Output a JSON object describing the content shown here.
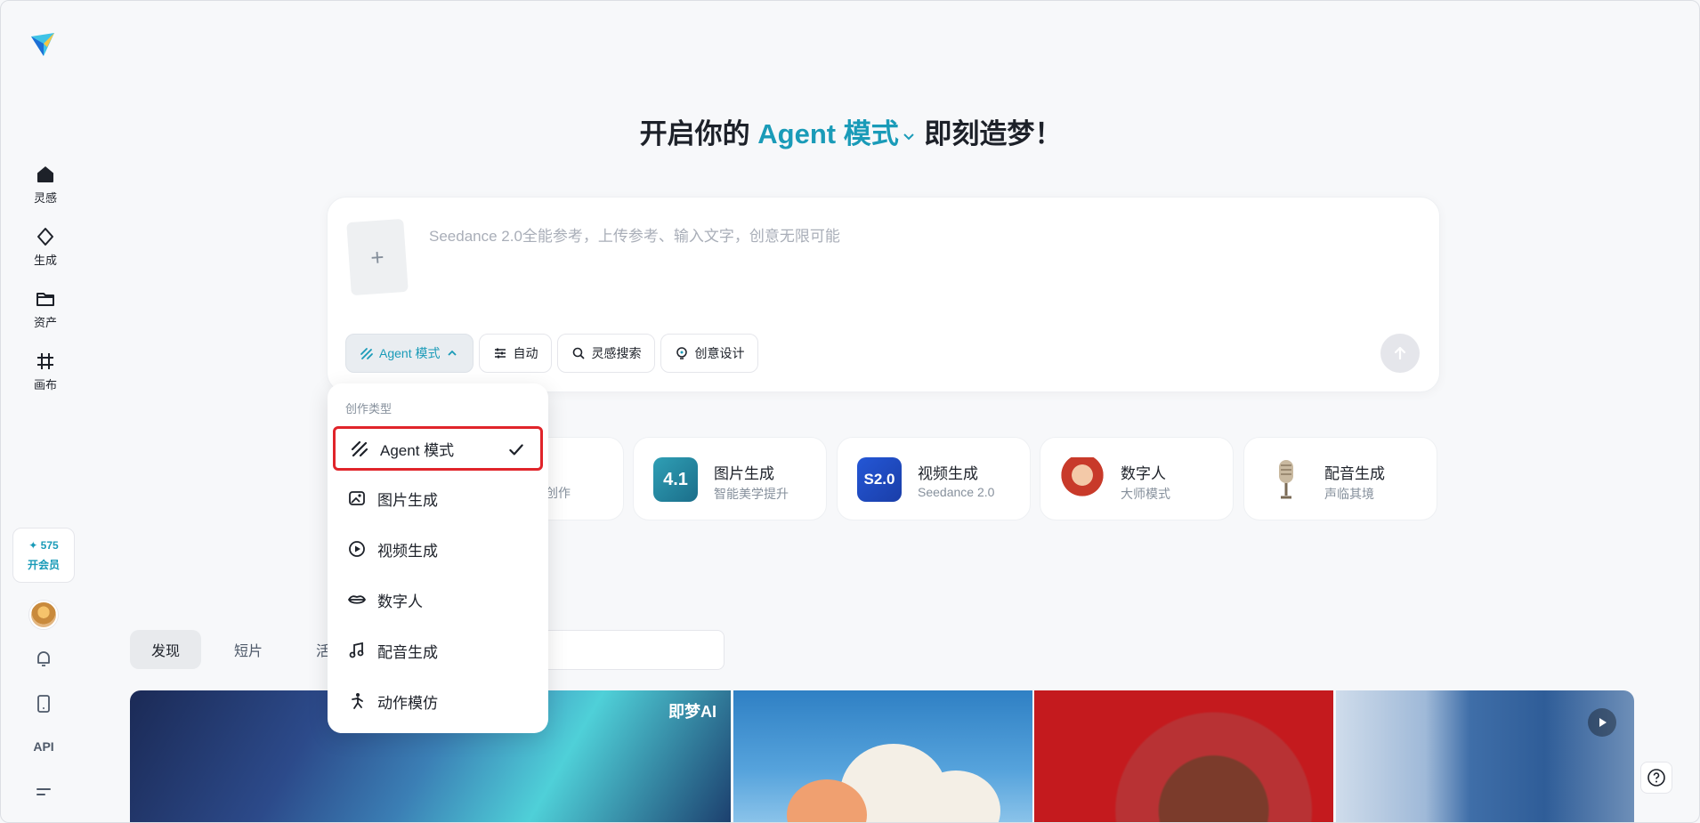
{
  "sidebar": {
    "nav": [
      {
        "label": "灵感",
        "icon": "home-icon"
      },
      {
        "label": "生成",
        "icon": "diamond-icon"
      },
      {
        "label": "资产",
        "icon": "folder-icon"
      },
      {
        "label": "画布",
        "icon": "canvas-icon"
      }
    ],
    "points": "✦ 575",
    "vip_label": "开会员",
    "api_label": "API"
  },
  "headline": {
    "prefix": "开启你的",
    "mode": "Agent 模式",
    "suffix": "即刻造梦！"
  },
  "prompt": {
    "placeholder": "Seedance 2.0全能参考，上传参考、输入文字，创意无限可能",
    "upload_symbol": "+",
    "tools": [
      {
        "label": "Agent 模式",
        "icon": "agent-icon",
        "active": true
      },
      {
        "label": "自动",
        "icon": "sliders-icon"
      },
      {
        "label": "灵感搜索",
        "icon": "search-spark-icon"
      },
      {
        "label": "创意设计",
        "icon": "idea-icon"
      }
    ]
  },
  "feature_cards": [
    {
      "partial_sub": "创作"
    },
    {
      "title": "图片生成",
      "sub": "智能美学提升",
      "badge": "4.1"
    },
    {
      "title": "视频生成",
      "sub": "Seedance 2.0",
      "badge": "S2.0"
    },
    {
      "title": "数字人",
      "sub": "大师模式"
    },
    {
      "title": "配音生成",
      "sub": "声临其境"
    }
  ],
  "tabs": [
    "发现",
    "短片",
    "活"
  ],
  "gallery": {
    "brand_text": "即梦AI"
  },
  "dropdown": {
    "header": "创作类型",
    "items": [
      {
        "label": "Agent 模式",
        "icon": "agent-icon",
        "selected": true
      },
      {
        "label": "图片生成",
        "icon": "image-gen-icon"
      },
      {
        "label": "视频生成",
        "icon": "video-gen-icon"
      },
      {
        "label": "数字人",
        "icon": "lips-icon"
      },
      {
        "label": "配音生成",
        "icon": "music-note-icon"
      },
      {
        "label": "动作模仿",
        "icon": "motion-icon"
      }
    ]
  },
  "colors": {
    "accent": "#1a9bb8",
    "selection_border": "#e0242a"
  }
}
